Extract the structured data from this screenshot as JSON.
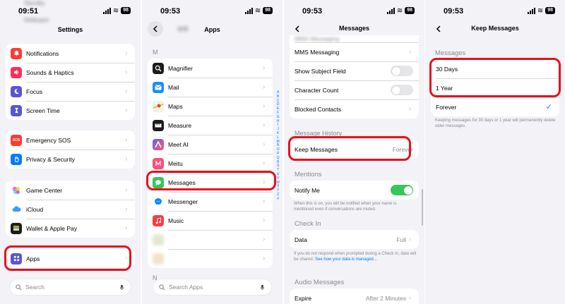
{
  "colors": {
    "highlight": "#e8101d",
    "link": "#007aff",
    "toggle_on": "#34c759",
    "check": "#007aff"
  },
  "screen1": {
    "time": "09:51",
    "battery": "98",
    "peek_top": "Standby",
    "peek_wallpaper": "Wallpaper",
    "title": "Settings",
    "group1": [
      {
        "label": "Notifications",
        "icon": "bell-icon",
        "color": "#ff3b30"
      },
      {
        "label": "Sounds & Haptics",
        "icon": "speaker-icon",
        "color": "#ff2d55"
      },
      {
        "label": "Focus",
        "icon": "moon-icon",
        "color": "#5856d6"
      },
      {
        "label": "Screen Time",
        "icon": "hourglass-icon",
        "color": "#5856d6"
      }
    ],
    "group2": [
      {
        "label": "Emergency SOS",
        "icon": "sos-icon",
        "color": "#ff3b30",
        "text": "SOS"
      },
      {
        "label": "Privacy & Security",
        "icon": "hand-icon",
        "color": "#007aff"
      }
    ],
    "group3": [
      {
        "label": "Game Center",
        "icon": "game-center-icon",
        "color": "#ffffff"
      },
      {
        "label": "iCloud",
        "icon": "cloud-icon",
        "color": "#ffffff"
      },
      {
        "label": "Wallet & Apple Pay",
        "icon": "wallet-icon",
        "color": "#1c1c1e"
      }
    ],
    "apps_label": "Apps",
    "search_placeholder": "Search"
  },
  "screen2": {
    "time": "09:53",
    "battery": "98",
    "back_label": "",
    "title": "Apps",
    "peek_blur": "绿茶",
    "section_m": "M",
    "items": [
      {
        "label": "Magnifier",
        "icon": "magnifier-icon",
        "color": "#1c1c1e"
      },
      {
        "label": "Mail",
        "icon": "mail-icon",
        "color": "#1a8cff"
      },
      {
        "label": "Maps",
        "icon": "maps-icon",
        "color": "#5ac85a"
      },
      {
        "label": "Measure",
        "icon": "measure-icon",
        "color": "#1c1c1e"
      },
      {
        "label": "Meet AI",
        "icon": "meet-ai-icon",
        "color": "#ff5a5a"
      },
      {
        "label": "Meitu",
        "icon": "meitu-icon",
        "color": "#ff4d7a"
      },
      {
        "label": "Messages",
        "icon": "messages-icon",
        "color": "#34c759"
      },
      {
        "label": "Messenger",
        "icon": "messenger-icon",
        "color": "#0084ff"
      },
      {
        "label": "Music",
        "icon": "music-icon",
        "color": "#fc3c44"
      }
    ],
    "section_n": "N",
    "search_placeholder": "Search Apps",
    "alphabet": [
      "A",
      "B",
      "C",
      "D",
      "E",
      "F",
      "G",
      "H",
      "I",
      "J",
      "K",
      "L",
      "M",
      "N",
      "O",
      "P",
      "Q",
      "R",
      "S",
      "T",
      "U",
      "V",
      "W",
      "X",
      "Y",
      "Z",
      "#"
    ]
  },
  "screen3": {
    "time": "09:53",
    "battery": "98",
    "title": "Messages",
    "peek_top": "MMS Messaging",
    "top_rows": [
      {
        "label": "MMS Messaging",
        "type": "chevron"
      },
      {
        "label": "Show Subject Field",
        "type": "toggle-off"
      },
      {
        "label": "Character Count",
        "type": "toggle-off"
      },
      {
        "label": "Blocked Contacts",
        "type": "chevron"
      }
    ],
    "history_header": "Message History",
    "keep_label": "Keep Messages",
    "keep_value": "Forever",
    "mentions_header": "Mentions",
    "notify_label": "Notify Me",
    "notify_footer": "When this is on, you will be notified when your name is mentioned even if conversations are muted.",
    "checkin_header": "Check In",
    "data_label": "Data",
    "data_value": "Full",
    "checkin_footer": "If you do not respond when prompted during a Check In, data will be shared.",
    "checkin_link": "See how your data is managed...",
    "audio_header": "Audio Messages",
    "expire_label": "Expire",
    "expire_value": "After 2 Minutes"
  },
  "screen4": {
    "time": "09:53",
    "battery": "98",
    "title": "Keep Messages",
    "section": "Messages",
    "options": [
      {
        "label": "30 Days",
        "checked": false
      },
      {
        "label": "1 Year",
        "checked": false
      },
      {
        "label": "Forever",
        "checked": true
      }
    ],
    "checkmark": "✓",
    "footer": "Keeping messages for 30 days or 1 year will permanently delete older messages."
  }
}
